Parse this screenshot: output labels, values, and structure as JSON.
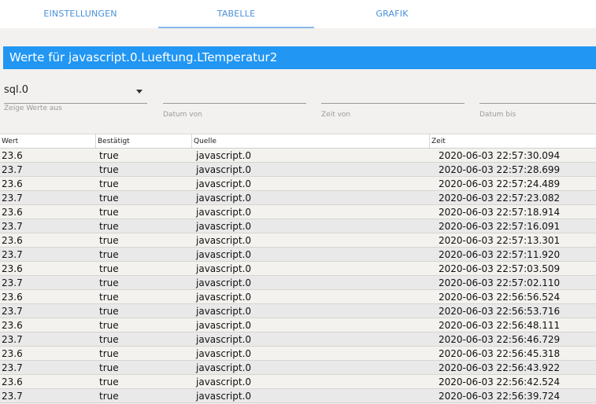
{
  "tabs": [
    {
      "label": "EINSTELLUNGEN"
    },
    {
      "label": "TABELLE"
    },
    {
      "label": "GRAFIK"
    }
  ],
  "active_tab": "TABELLE",
  "title": "Werte für javascript.0.Lueftung.LTemperatur2",
  "filters": {
    "instance_value": "sql.0",
    "instance_helper": "Zeige Werte aus",
    "date_from_label": "Datum von",
    "time_from_label": "Zeit von",
    "date_to_label": "Datum bis"
  },
  "table": {
    "headers": [
      "Wert",
      "Bestätigt",
      "Quelle",
      "Zeit"
    ],
    "rows": [
      [
        "23.6",
        "true",
        "javascript.0",
        "2020-06-03 22:57:30.094"
      ],
      [
        "23.7",
        "true",
        "javascript.0",
        "2020-06-03 22:57:28.699"
      ],
      [
        "23.6",
        "true",
        "javascript.0",
        "2020-06-03 22:57:24.489"
      ],
      [
        "23.7",
        "true",
        "javascript.0",
        "2020-06-03 22:57:23.082"
      ],
      [
        "23.6",
        "true",
        "javascript.0",
        "2020-06-03 22:57:18.914"
      ],
      [
        "23.7",
        "true",
        "javascript.0",
        "2020-06-03 22:57:16.091"
      ],
      [
        "23.6",
        "true",
        "javascript.0",
        "2020-06-03 22:57:13.301"
      ],
      [
        "23.7",
        "true",
        "javascript.0",
        "2020-06-03 22:57:11.920"
      ],
      [
        "23.6",
        "true",
        "javascript.0",
        "2020-06-03 22:57:03.509"
      ],
      [
        "23.7",
        "true",
        "javascript.0",
        "2020-06-03 22:57:02.110"
      ],
      [
        "23.6",
        "true",
        "javascript.0",
        "2020-06-03 22:56:56.524"
      ],
      [
        "23.7",
        "true",
        "javascript.0",
        "2020-06-03 22:56:53.716"
      ],
      [
        "23.6",
        "true",
        "javascript.0",
        "2020-06-03 22:56:48.111"
      ],
      [
        "23.7",
        "true",
        "javascript.0",
        "2020-06-03 22:56:46.729"
      ],
      [
        "23.6",
        "true",
        "javascript.0",
        "2020-06-03 22:56:45.318"
      ],
      [
        "23.7",
        "true",
        "javascript.0",
        "2020-06-03 22:56:43.922"
      ],
      [
        "23.6",
        "true",
        "javascript.0",
        "2020-06-03 22:56:42.524"
      ],
      [
        "23.7",
        "true",
        "javascript.0",
        "2020-06-03 22:56:39.724"
      ]
    ]
  },
  "colors": {
    "accent": "#2196f3",
    "tab_text": "#4a90d9",
    "background": "#f3f1ef"
  }
}
